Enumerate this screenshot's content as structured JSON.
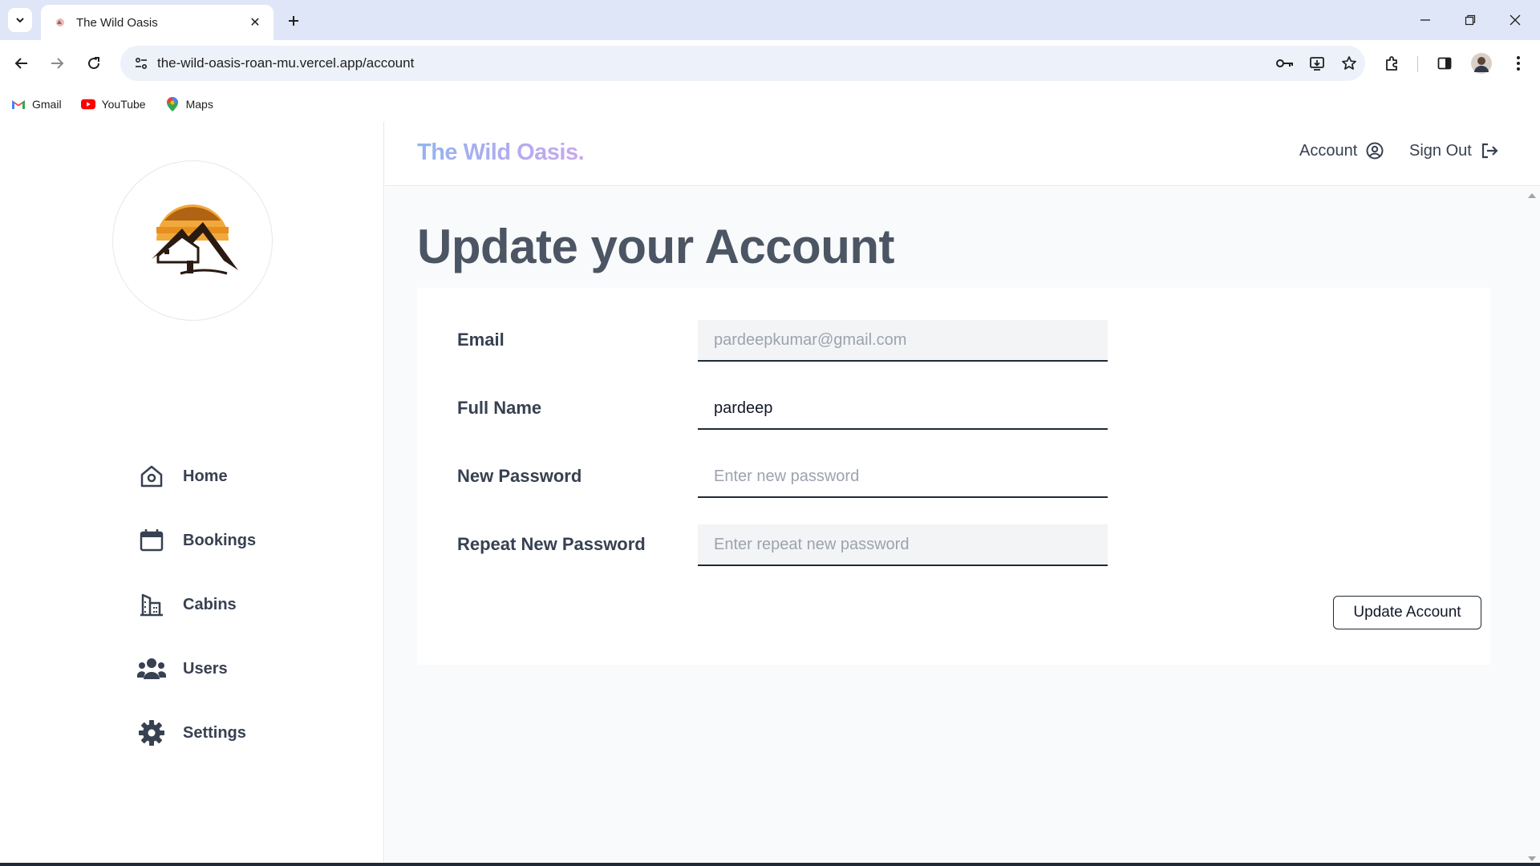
{
  "browser": {
    "tab_title": "The Wild Oasis",
    "url": "the-wild-oasis-roan-mu.vercel.app/account",
    "bookmarks": [
      {
        "label": "Gmail",
        "icon": "gmail-icon"
      },
      {
        "label": "YouTube",
        "icon": "youtube-icon"
      },
      {
        "label": "Maps",
        "icon": "maps-icon"
      }
    ]
  },
  "header": {
    "brand": "The Wild Oasis.",
    "account_label": "Account",
    "signout_label": "Sign Out"
  },
  "sidebar": {
    "logo": "mountain-house-logo",
    "items": [
      {
        "label": "Home",
        "icon": "home-icon"
      },
      {
        "label": "Bookings",
        "icon": "calendar-icon"
      },
      {
        "label": "Cabins",
        "icon": "building-icon"
      },
      {
        "label": "Users",
        "icon": "users-icon"
      },
      {
        "label": "Settings",
        "icon": "gear-icon"
      }
    ]
  },
  "main": {
    "title": "Update your Account",
    "form": {
      "email_label": "Email",
      "email_value": "pardeepkumar@gmail.com",
      "fullname_label": "Full Name",
      "fullname_value": "pardeep",
      "password_label": "New Password",
      "password_placeholder": "Enter new password",
      "repeat_label": "Repeat New Password",
      "repeat_placeholder": "Enter repeat new password",
      "submit_label": "Update Account"
    }
  },
  "colors": {
    "brand_gradient_start": "#93b4ee",
    "brand_gradient_end": "#c9a7ee",
    "text": "#374151",
    "main_bg": "#f9fafb"
  }
}
